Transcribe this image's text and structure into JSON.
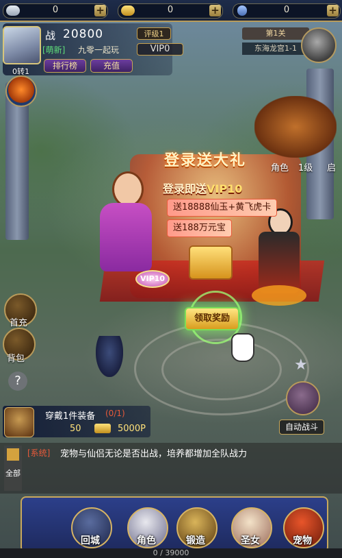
{
  "currencies": [
    {
      "name": "silver-icon",
      "value": "0"
    },
    {
      "name": "gold-icon",
      "value": "0"
    },
    {
      "name": "gem-icon",
      "value": "0"
    }
  ],
  "player": {
    "power_label": "战",
    "power_value": "20800",
    "rank_badge": "评级1",
    "guild_tag": "[萌新]",
    "guild_name": "九零一起玩",
    "vip_label": "VIP0",
    "level_text": "0转1",
    "ranking_button": "排行榜",
    "recharge_button": "充值"
  },
  "stage": {
    "level": "第1关",
    "location": "东海龙宫1-1"
  },
  "event": {
    "title": "登录送大礼",
    "subtitle_prefix": "登录即送",
    "subtitle_vip": "VIP10",
    "reward_1": "送18888仙玉+黄飞虎卡",
    "reward_2": "送188万元宝",
    "vip_badge": "VIP10",
    "claim_button": "领取奖励"
  },
  "scene": {
    "npc_label": "角色",
    "npc_level": "1级",
    "npc_extra": "启"
  },
  "sidebar": {
    "first_recharge": "首充",
    "backpack": "背包",
    "help": "?",
    "auto_battle": "自动战斗"
  },
  "quest": {
    "title": "穿戴1件装备",
    "progress": "(0/1)",
    "reward_gold": "50",
    "reward_exp": "5000P"
  },
  "chat": {
    "channel_tag": "[系统]",
    "message": "宠物与仙侣无论是否出战，培养都增加全队战力",
    "all_tab": "全部"
  },
  "bottom_nav": [
    {
      "name": "return-city",
      "label": "回城"
    },
    {
      "name": "character",
      "label": "角色"
    },
    {
      "name": "forge",
      "label": "锻造"
    },
    {
      "name": "goddess",
      "label": "圣女"
    },
    {
      "name": "pet",
      "label": "宠物"
    }
  ],
  "exp": {
    "text": "0 / 39000",
    "fraction": 0
  },
  "colors": {
    "accent_gold": "#d8c67b",
    "panel_navy": "#1e2c4a",
    "claim_green": "#7bdc57",
    "event_red": "#c73a1a"
  }
}
